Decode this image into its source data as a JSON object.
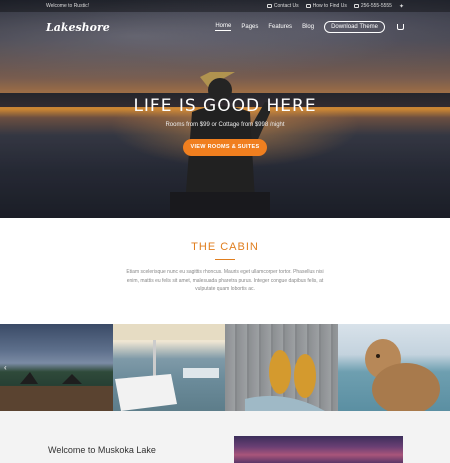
{
  "topbar": {
    "welcome": "Welcome to Rustic!",
    "items": [
      "Contact Us",
      "How to Find Us",
      "256-555-5555"
    ]
  },
  "nav": {
    "logo": "Lakeshore",
    "links": [
      "Home",
      "Pages",
      "Features",
      "Blog"
    ],
    "cta": "Download Theme"
  },
  "hero": {
    "title": "LIFE IS GOOD HERE",
    "subtitle": "Rooms from $99 or Cottage from $998 /night",
    "button": "VIEW ROOMS & SUITES"
  },
  "cabin": {
    "title": "THE CABIN",
    "body": "Etiam scelerisque nunc eu sagittis rhoncus. Mauris eget ullamcorper tortor. Phasellus nisi enim, mattis eu felis sit amet, malesuada pharetra purus. Integer congue dapibus felis, at vulputate quam lobortis ac."
  },
  "gallery": {
    "prev": "‹"
  },
  "welcome": {
    "title": "Welcome to Muskoka Lake"
  }
}
